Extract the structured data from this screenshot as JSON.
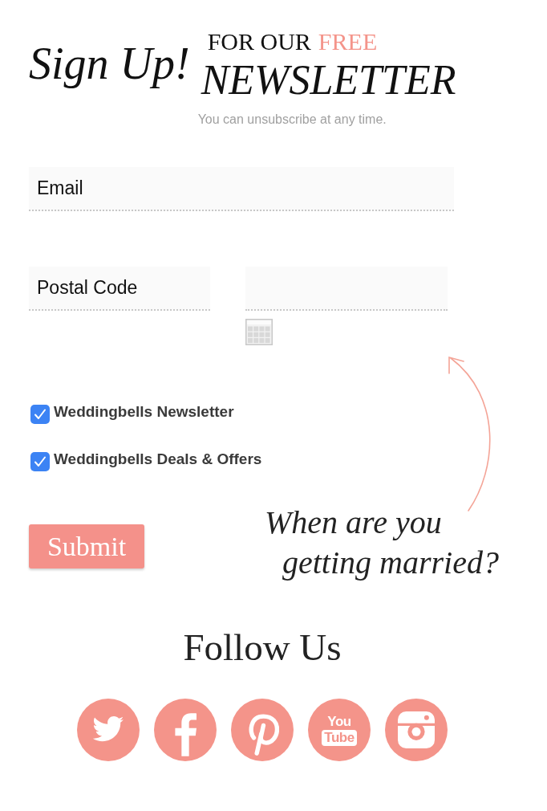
{
  "header": {
    "script_title": "Sign Up!",
    "kicker": [
      {
        "text": "FOR OUR",
        "highlight": false
      },
      {
        "text": "FREE",
        "highlight": true
      }
    ],
    "headline": "NEWSLETTER",
    "note": "You can unsubscribe at any time."
  },
  "field_rows": [
    [
      {
        "kind": "text",
        "placeholder": "Email"
      }
    ],
    [
      {
        "kind": "text",
        "placeholder": "Postal Code"
      },
      {
        "kind": "date"
      }
    ]
  ],
  "checkboxes": [
    {
      "label": "Weddingbells Newsletter",
      "checked": true
    },
    {
      "label": "Weddingbells Deals & Offers",
      "checked": true
    }
  ],
  "submit_button": "Submit",
  "callout": "When are you getting married?",
  "follow": {
    "title": "Follow Us",
    "links": [
      {
        "kind": "twitter"
      },
      {
        "kind": "facebook"
      },
      {
        "kind": "pinterest"
      },
      {
        "kind": "youtube",
        "logo_top": "You",
        "logo_bottom": "Tube"
      },
      {
        "kind": "instagram"
      }
    ]
  }
}
